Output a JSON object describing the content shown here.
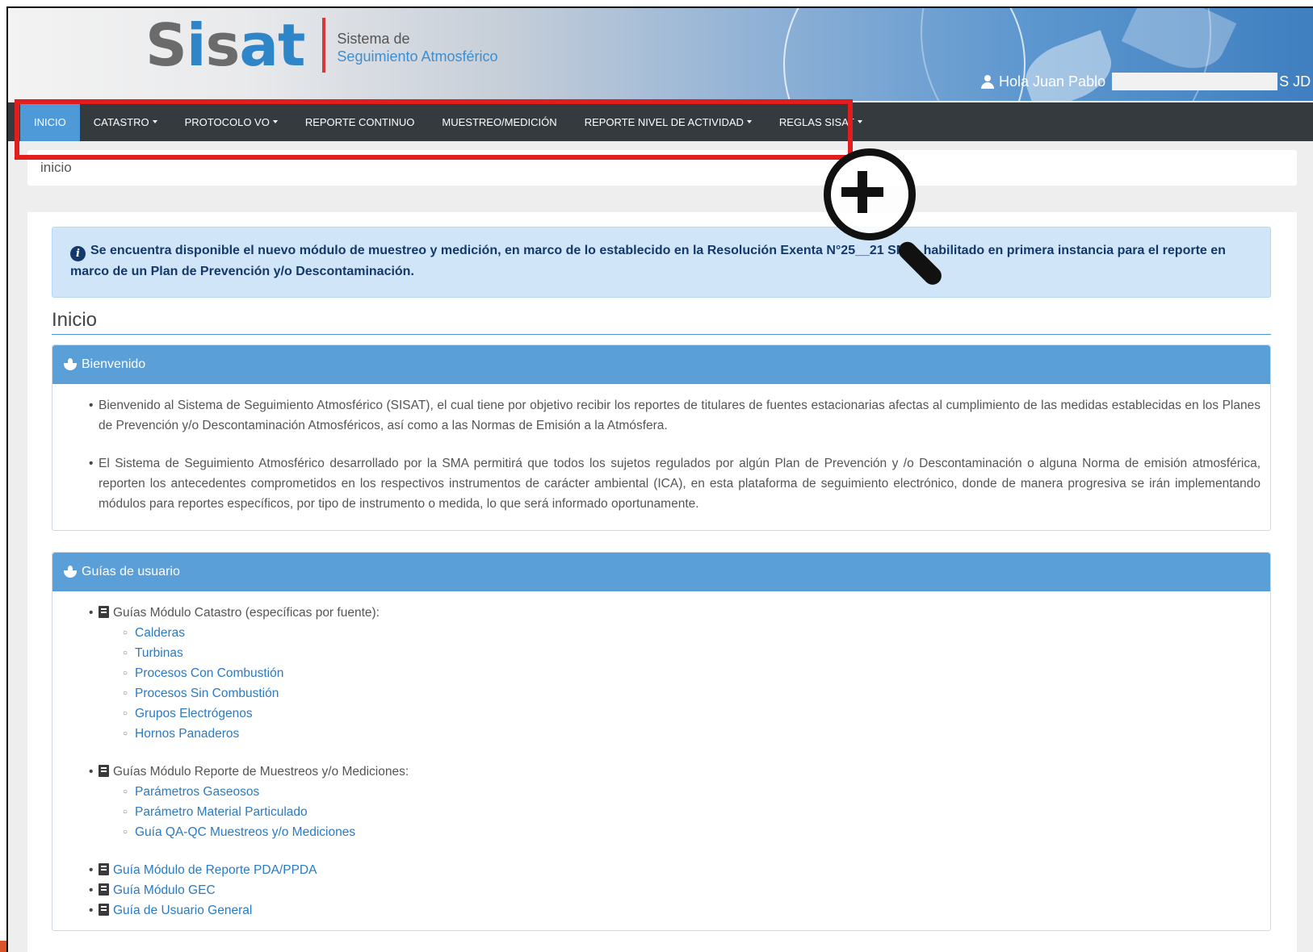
{
  "header": {
    "logo_main": "Sisat",
    "logo_sub_line1": "Sistema de",
    "logo_sub_line2": "Seguimiento Atmosférico",
    "user_greeting": "Hola Juan Pablo",
    "user_suffix": "S JD"
  },
  "navbar": {
    "items": [
      {
        "label": "INICIO",
        "active": true
      },
      {
        "label": "CATASTRO",
        "dropdown": true
      },
      {
        "label": "PROTOCOLO VO",
        "dropdown": true
      },
      {
        "label": "REPORTE CONTINUO"
      },
      {
        "label": "MUESTREO/MEDICIÓN"
      },
      {
        "label": "REPORTE NIVEL DE ACTIVIDAD",
        "dropdown": true
      },
      {
        "label": "REGLAS SISAT",
        "dropdown": true
      }
    ]
  },
  "breadcrumb": "inicio",
  "alert": {
    "icon": "info-icon",
    "text": "Se encuentra disponible el nuevo módulo de muestreo y medición, en marco de lo establecido en la Resolución Exenta N°25__21 SMA, habilitado en primera instancia para el reporte en marco de un Plan de Prevención y/o Descontaminación."
  },
  "section_title": "Inicio",
  "welcome": {
    "title": "Bienvenido",
    "paragraphs": [
      "Bienvenido al Sistema de Seguimiento Atmosférico (SISAT), el cual tiene por objetivo recibir los reportes de titulares de fuentes estacionarias afectas al cumplimiento de las medidas establecidas en los Planes de Prevención y/o Descontaminación Atmosféricos, así como a las Normas de Emisión a la Atmósfera.",
      "El Sistema de Seguimiento Atmosférico desarrollado por la SMA permitirá que todos los sujetos regulados por algún Plan de Prevención y /o Descontaminación o alguna Norma de emisión atmosférica, reporten los antecedentes comprometidos en los respectivos instrumentos de carácter ambiental (ICA), en esta plataforma de seguimiento electrónico, donde de manera progresiva se irán implementando módulos para reportes específicos, por tipo de instrumento o medida, lo que será informado oportunamente."
    ]
  },
  "guides": {
    "title": "Guías de usuario",
    "catastro_label": "Guías Módulo Catastro (específicas por fuente):",
    "catastro_links": [
      "Calderas",
      "Turbinas",
      "Procesos Con Combustión",
      "Procesos Sin Combustión",
      "Grupos Electrógenos",
      "Hornos Panaderos"
    ],
    "muestreo_label": "Guías Módulo Reporte de Muestreos y/o Mediciones:",
    "muestreo_links": [
      "Parámetros Gaseosos",
      "Parámetro Material Particulado",
      "Guía QA-QC Muestreos y/o Mediciones"
    ],
    "other_links": [
      "Guía Módulo de Reporte PDA/PPDA",
      "Guía Módulo GEC",
      "Guía de Usuario General"
    ]
  },
  "colors": {
    "navbar_bg": "#353a3e",
    "active_tab": "#4e9ad8",
    "card_header": "#5b9fd9",
    "highlight": "#e21d1d",
    "link": "#2a7ac4"
  }
}
